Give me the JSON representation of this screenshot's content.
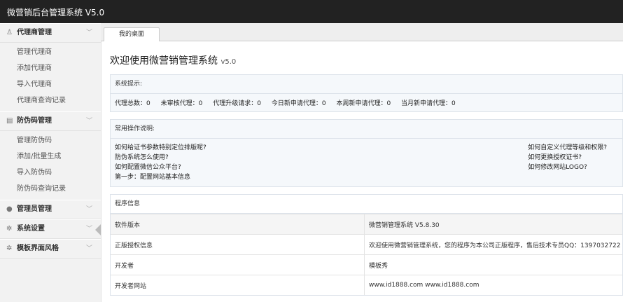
{
  "app": {
    "title": "微营销后台管理系统 V5.0"
  },
  "sidebar": {
    "groups": [
      {
        "label": "代理商管理",
        "icon": "user-icon",
        "items": [
          "管理代理商",
          "添加代理商",
          "导入代理商",
          "代理商查询记录"
        ]
      },
      {
        "label": "防伪码管理",
        "icon": "barcode-icon",
        "items": [
          "管理防伪码",
          "添加/批量生成",
          "导入防伪码",
          "防伪码查询记录"
        ]
      },
      {
        "label": "管理员管理",
        "icon": "admin-user-icon",
        "items": []
      },
      {
        "label": "系统设置",
        "icon": "gear-icon",
        "items": []
      },
      {
        "label": "模板界面风格",
        "icon": "palette-icon",
        "items": []
      }
    ]
  },
  "tabs": {
    "active": "我的桌面"
  },
  "welcome": {
    "title": "欢迎使用微营销管理系统",
    "version": "v5.0"
  },
  "system_notice": {
    "header": "系统提示:",
    "stats": [
      "代理总数：0",
      "未审核代理：0",
      "代理升级请求：0",
      "今日新申请代理：0",
      "本周新申请代理：0",
      "当月新申请代理：0"
    ]
  },
  "help": {
    "header": "常用操作说明:",
    "left": [
      "如何给证书参数特别定位排版呢?",
      "防伪系统怎么使用?",
      "如何配置微信公众平台?",
      "第一步：配置网站基本信息"
    ],
    "right": [
      "如何自定义代理等级和权限?",
      "如何更换授权证书?",
      "如何修改网站LOGO?"
    ]
  },
  "program_info": {
    "header": "程序信息",
    "rows": [
      {
        "key": "软件版本",
        "value": "微营销管理系统 V5.8.30"
      },
      {
        "key": "正版授权信息",
        "value": "欢迎使用微营销管理系统，您的程序为本公司正版程序，售后技术专员QQ：1397032722"
      },
      {
        "key": "开发者",
        "value": "模板秀"
      },
      {
        "key": "开发者网站",
        "value": "www.id1888.com www.id1888.com"
      }
    ]
  }
}
